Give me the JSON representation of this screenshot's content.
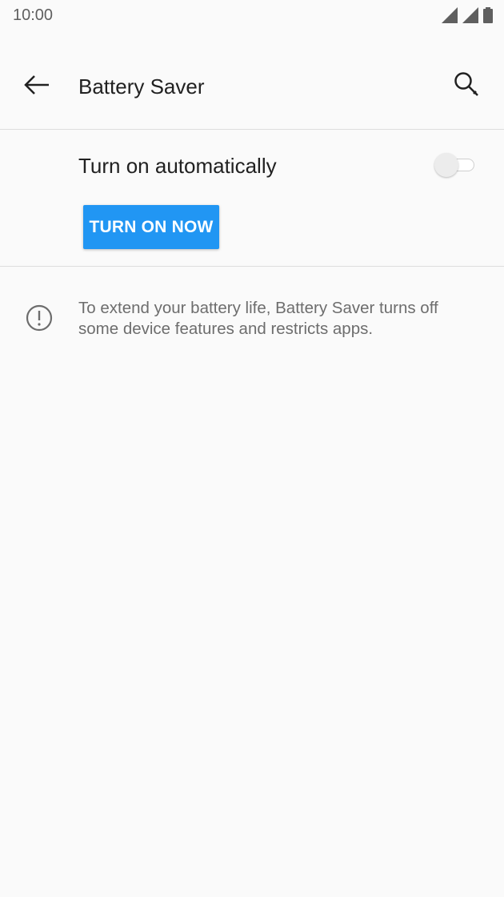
{
  "status_bar": {
    "time": "10:00",
    "icons": [
      "signal-icon",
      "signal-icon",
      "battery-icon"
    ]
  },
  "app_bar": {
    "title": "Battery Saver",
    "back_icon": "arrow-left-icon",
    "search_icon": "search-icon"
  },
  "settings": {
    "auto_label": "Turn on automatically",
    "auto_enabled": false,
    "turn_on_now_label": "TURN ON NOW"
  },
  "info": {
    "icon": "info-icon",
    "text": "To extend your battery life, Battery Saver turns off some device features and restricts apps."
  },
  "colors": {
    "accent": "#2196f3",
    "background": "#fafafa",
    "divider": "#dddddd",
    "secondary_text": "#6d6d6d"
  }
}
